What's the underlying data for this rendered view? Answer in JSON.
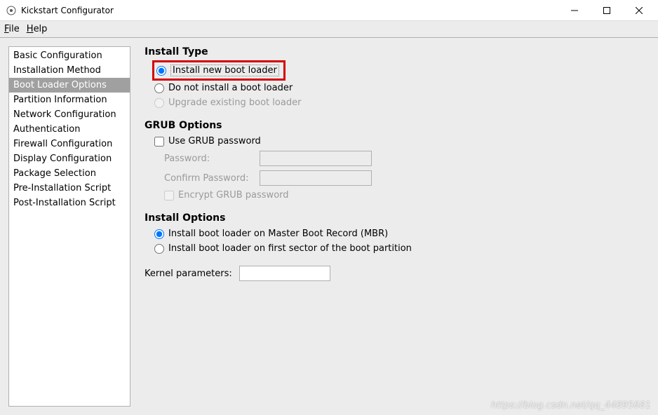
{
  "window": {
    "title": "Kickstart Configurator"
  },
  "menu": {
    "file": "File",
    "help": "Help"
  },
  "sidebar": {
    "items": [
      {
        "label": "Basic Configuration"
      },
      {
        "label": "Installation Method"
      },
      {
        "label": "Boot Loader Options"
      },
      {
        "label": "Partition Information"
      },
      {
        "label": "Network Configuration"
      },
      {
        "label": "Authentication"
      },
      {
        "label": "Firewall Configuration"
      },
      {
        "label": "Display Configuration"
      },
      {
        "label": "Package Selection"
      },
      {
        "label": "Pre-Installation Script"
      },
      {
        "label": "Post-Installation Script"
      }
    ],
    "selected_index": 2
  },
  "sections": {
    "install_type": {
      "heading": "Install Type",
      "opt_new": "Install new boot loader",
      "opt_none": "Do not install a boot loader",
      "opt_upgrade": "Upgrade existing boot loader"
    },
    "grub": {
      "heading": "GRUB Options",
      "use_password": "Use GRUB password",
      "password_label": "Password:",
      "confirm_label": "Confirm Password:",
      "encrypt": "Encrypt GRUB password"
    },
    "install_options": {
      "heading": "Install Options",
      "mbr": "Install boot loader on Master Boot Record (MBR)",
      "first_sector": "Install boot loader on first sector of the boot partition"
    },
    "kernel": {
      "label": "Kernel parameters:",
      "value": ""
    }
  },
  "watermark": "https://blog.csdn.net/qq_44895681"
}
